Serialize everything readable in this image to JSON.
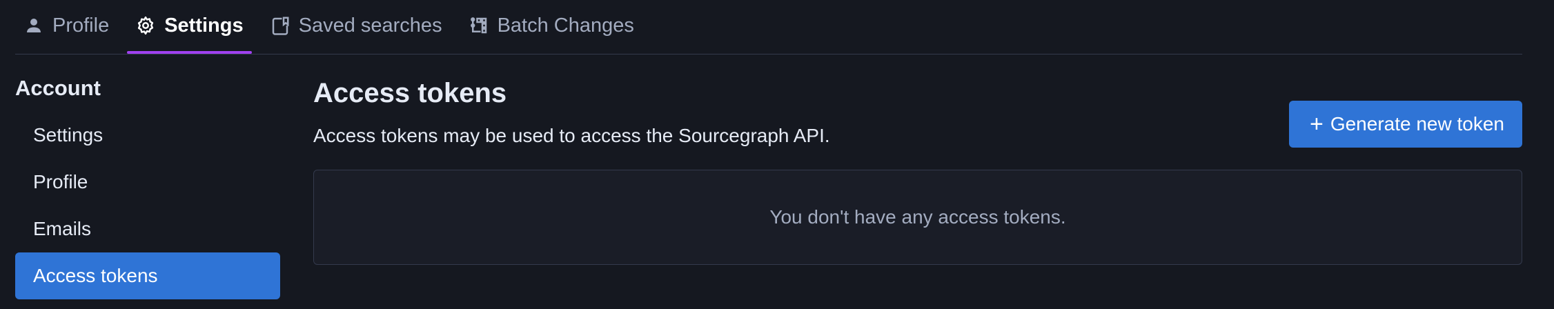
{
  "colors": {
    "background": "#151820",
    "accent_blue": "#2f74d6",
    "tab_underline": "#a040f0",
    "muted_text": "#a3acc0"
  },
  "tabs": [
    {
      "label": "Profile",
      "icon": "person-icon",
      "active": false
    },
    {
      "label": "Settings",
      "icon": "gear-icon",
      "active": true
    },
    {
      "label": "Saved searches",
      "icon": "saved-search-icon",
      "active": false
    },
    {
      "label": "Batch Changes",
      "icon": "batch-changes-icon",
      "active": false
    }
  ],
  "sidebar": {
    "heading": "Account",
    "items": [
      {
        "label": "Settings",
        "active": false
      },
      {
        "label": "Profile",
        "active": false
      },
      {
        "label": "Emails",
        "active": false
      },
      {
        "label": "Access tokens",
        "active": true
      }
    ]
  },
  "main": {
    "title": "Access tokens",
    "description": "Access tokens may be used to access the Sourcegraph API.",
    "generate_button_label": "Generate new token",
    "empty_message": "You don't have any access tokens."
  }
}
